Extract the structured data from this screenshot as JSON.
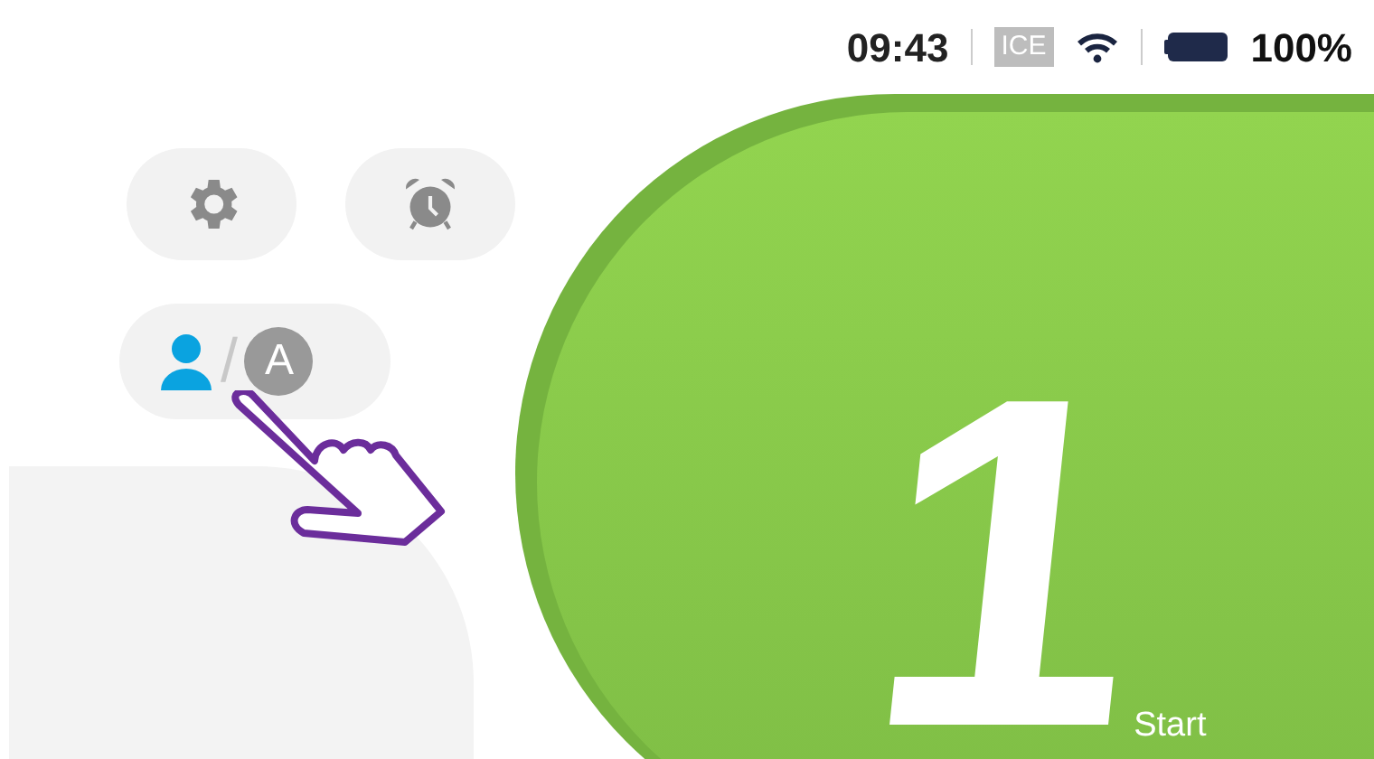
{
  "status_bar": {
    "time": "09:43",
    "network": "ICE",
    "battery": "100%"
  },
  "toolbar": {
    "buttons": [
      {
        "kind": "settings"
      },
      {
        "kind": "alarm"
      }
    ]
  },
  "mode_toggle": {
    "separator": "/",
    "items": [
      {
        "kind": "user",
        "selected": true
      },
      {
        "kind": "auto",
        "label": "A",
        "selected": false
      }
    ]
  },
  "start_button": {
    "number": "1",
    "label": "Start"
  }
}
